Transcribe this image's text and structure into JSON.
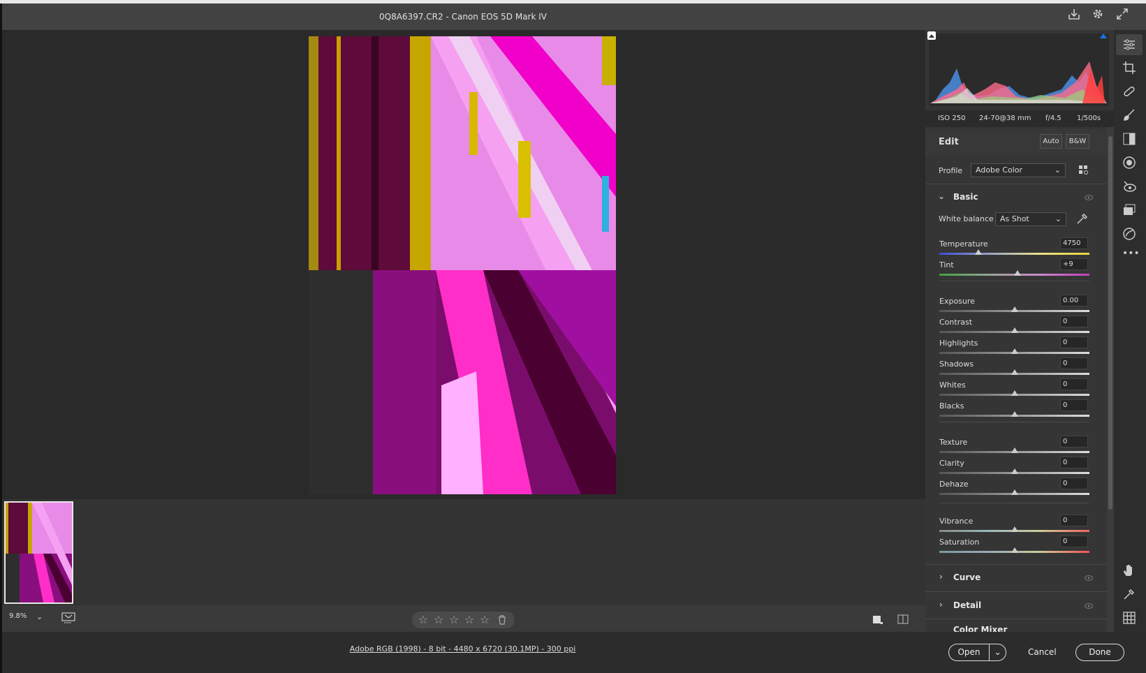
{
  "window": {
    "title": "0Q8A6397.CR2  -  Canon EOS 5D Mark IV"
  },
  "status": {
    "zoom": "9.8%",
    "file_info": "Adobe RGB (1998) - 8 bit - 4480 x 6720 (30.1MP) - 300 ppi"
  },
  "rating": {
    "stars": [
      "☆",
      "☆",
      "☆",
      "☆",
      "☆"
    ]
  },
  "buttons": {
    "open": "Open",
    "cancel": "Cancel",
    "done": "Done",
    "auto": "Auto",
    "bw": "B&W"
  },
  "exif": {
    "iso": "ISO 250",
    "lens": "24-70@38 mm",
    "aperture": "f/4.5",
    "shutter": "1/500s"
  },
  "edit": {
    "heading": "Edit",
    "profile_label": "Profile",
    "profile_value": "Adobe Color"
  },
  "basic": {
    "title": "Basic",
    "wb_label": "White balance",
    "wb_value": "As Shot",
    "sliders": [
      {
        "label": "Temperature",
        "value": "4750",
        "pos": 0.26
      },
      {
        "label": "Tint",
        "value": "+9",
        "pos": 0.52
      },
      {
        "label": "Exposure",
        "value": "0.00",
        "pos": 0.5
      },
      {
        "label": "Contrast",
        "value": "0",
        "pos": 0.5
      },
      {
        "label": "Highlights",
        "value": "0",
        "pos": 0.5
      },
      {
        "label": "Shadows",
        "value": "0",
        "pos": 0.5
      },
      {
        "label": "Whites",
        "value": "0",
        "pos": 0.5
      },
      {
        "label": "Blacks",
        "value": "0",
        "pos": 0.5
      },
      {
        "label": "Texture",
        "value": "0",
        "pos": 0.5
      },
      {
        "label": "Clarity",
        "value": "0",
        "pos": 0.5
      },
      {
        "label": "Dehaze",
        "value": "0",
        "pos": 0.5
      },
      {
        "label": "Vibrance",
        "value": "0",
        "pos": 0.5
      },
      {
        "label": "Saturation",
        "value": "0",
        "pos": 0.5
      }
    ]
  },
  "panels": {
    "curve": "Curve",
    "detail": "Detail",
    "color_mixer": "Color Mixer"
  },
  "colors": {
    "accent_blue": "#1473e6",
    "panel_bg": "#353535"
  }
}
